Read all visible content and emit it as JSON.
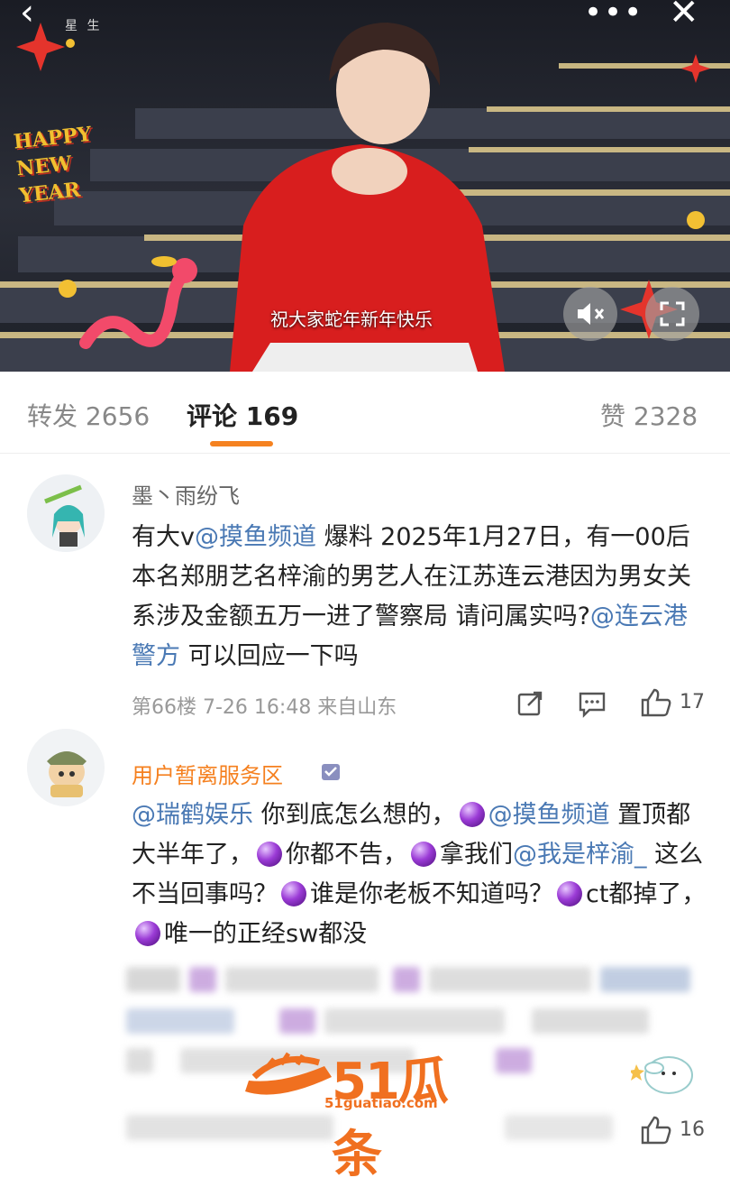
{
  "video": {
    "logo_text": "星 生",
    "subtitle": "祝大家蛇年新年快乐",
    "sticker_text": [
      "HAPPY",
      "NEW",
      "YEAR"
    ]
  },
  "tabs": {
    "repost": "转发 2656",
    "comments": "评论 169",
    "likes": "赞 2328"
  },
  "comment1": {
    "username": "墨丶雨纷飞",
    "text_a": "有大v",
    "mention1": "@摸鱼频道",
    "text_b": " 爆料 2025年1月27日，有一00后本名郑朋艺名梓渝的男艺人在江苏连云港因为男女关系涉及金额五万一进了警察局 请问属实吗?",
    "mention2": "@连云港警方",
    "text_c": " 可以回应一下吗",
    "meta": "第66楼 7-26 16:48 来自山东",
    "likes": "17"
  },
  "comment2": {
    "username": "用户暂离服务区",
    "mention1": "@瑞鹤娱乐",
    "text_a": " 你到底怎么想的，",
    "mention2": "@摸鱼频道",
    "text_b": "置顶都大半年了，",
    "text_c": "你都不告，",
    "text_d": "拿我们",
    "mention3": "@我是梓渝_",
    "text_e": " 这么不当回事吗？",
    "text_f": "谁是你老板不知道吗？",
    "text_g": "ct都掉了，",
    "text_h": "唯一的正经sw都没",
    "likes": "16"
  },
  "watermark": {
    "text": "51瓜条",
    "url": "51guatiao.com"
  },
  "colors": {
    "accent": "#f58220",
    "mention": "#4a79b4",
    "vip_name": "#f5801f"
  }
}
